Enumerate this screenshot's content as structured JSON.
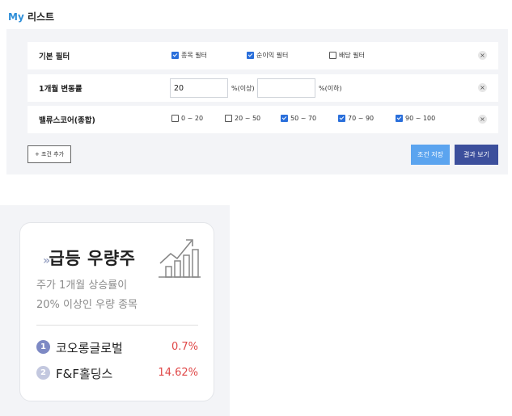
{
  "header": {
    "title_prefix": "My",
    "title_suffix": " 리스트"
  },
  "filters": {
    "row1": {
      "label": "기본 필터",
      "options": [
        {
          "label": "종목 필터",
          "checked": true
        },
        {
          "label": "순이익 필터",
          "checked": true
        },
        {
          "label": "배당 필터",
          "checked": false
        }
      ]
    },
    "row2": {
      "label": "1개월 변동률",
      "min_value": "20",
      "min_unit": "%(이상)",
      "max_value": "",
      "max_unit": "%(이하)"
    },
    "row3": {
      "label": "밸류스코어(종합)",
      "options": [
        {
          "label": "0 ~ 20",
          "checked": false
        },
        {
          "label": "20 ~ 50",
          "checked": false
        },
        {
          "label": "50 ~ 70",
          "checked": true
        },
        {
          "label": "70 ~ 90",
          "checked": true
        },
        {
          "label": "90 ~ 100",
          "checked": true
        }
      ]
    },
    "remove_symbol": "×"
  },
  "actions": {
    "add_condition": "+ 조건 추가",
    "save_condition": "조건 저장",
    "view_results": "결과 보기"
  },
  "card": {
    "arrow": "»",
    "title": "급등 우량주",
    "desc_line1": "주가 1개월 상승률이",
    "desc_line2": "20% 이상인 우량 종목",
    "icon": "growth-chart-icon",
    "items": [
      {
        "rank": "1",
        "name": "코오롱글로벌",
        "change": "0.7%"
      },
      {
        "rank": "2",
        "name": "F&F홀딩스",
        "change": "14.62%"
      }
    ]
  },
  "colors": {
    "accent_blue": "#2f8fd9",
    "checkbox_blue": "#2a6fdb",
    "save_button": "#5ba4ef",
    "result_button": "#3c4f9c",
    "positive_red": "#e04848"
  }
}
